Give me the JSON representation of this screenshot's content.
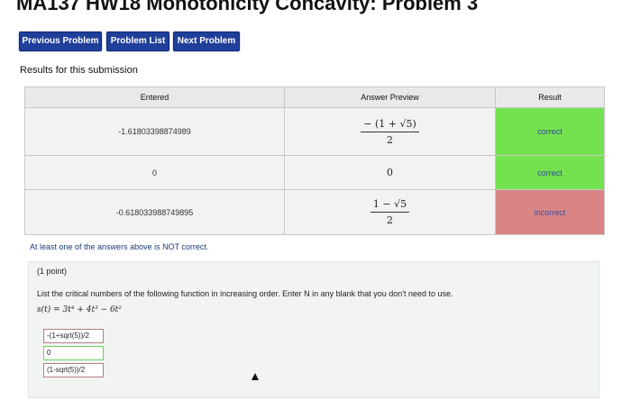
{
  "page": {
    "title": "MA137 HW18 Monotonicity Concavity: Problem 3"
  },
  "nav": {
    "previous": "Previous Problem",
    "list": "Problem List",
    "next": "Next Problem"
  },
  "results": {
    "heading": "Results for this submission",
    "columns": [
      "Entered",
      "Answer Preview",
      "Result"
    ],
    "rows": [
      {
        "entered": "-1.61803398874989",
        "preview_num": "− (1 + √5)",
        "preview_den": "2",
        "result": "correct"
      },
      {
        "entered": "0",
        "preview": "0",
        "result": "correct"
      },
      {
        "entered": "-0.618033988749895",
        "preview_num": "1 − √5",
        "preview_den": "2",
        "result": "incorrect"
      }
    ],
    "warning": "At least one of the answers above is NOT correct."
  },
  "problem": {
    "points": "(1 point)",
    "instruction": "List the critical numbers of the following function in increasing order. Enter N in any blank that you don't need to use.",
    "function": "s(t) = 3t⁴ + 4t³ − 6t²",
    "answers": [
      "-(1+sqrt(5))/2",
      "0",
      "(1-sqrt(5))/2"
    ]
  },
  "colors": {
    "nav_button": "#1f3f9a",
    "correct": "#74e24f",
    "incorrect": "#d98585"
  }
}
